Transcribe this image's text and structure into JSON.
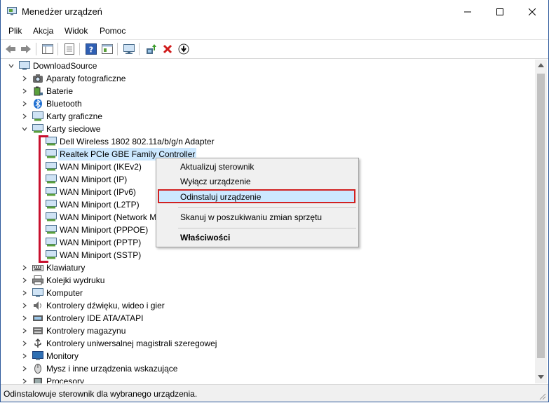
{
  "window": {
    "title": "Menedżer urządzeń",
    "controls": [
      "minimize",
      "maximize",
      "close"
    ]
  },
  "menu": [
    "Plik",
    "Akcja",
    "Widok",
    "Pomoc"
  ],
  "toolbar": {
    "buttons": [
      "back-icon",
      "forward-icon",
      "show-hide-tree-icon",
      "properties-icon",
      "help-icon",
      "view-icon",
      "monitor-icon",
      "update-driver-icon",
      "uninstall-icon",
      "download-icon"
    ]
  },
  "tree": {
    "root": "DownloadSource",
    "categories_before": [
      "Aparaty fotograficzne",
      "Baterie",
      "Bluetooth",
      "Karty graficzne"
    ],
    "expanded_category": "Karty sieciowe",
    "network_adapters": [
      "Dell Wireless 1802 802.11a/b/g/n Adapter",
      "Realtek PCIe GBE Family Controller",
      "WAN Miniport (IKEv2)",
      "WAN Miniport (IP)",
      "WAN Miniport (IPv6)",
      "WAN Miniport (L2TP)",
      "WAN Miniport (Network Monitor)",
      "WAN Miniport (PPPOE)",
      "WAN Miniport (PPTP)",
      "WAN Miniport (SSTP)"
    ],
    "selected_adapter": "Realtek PCIe GBE Family Controller",
    "categories_after": [
      "Klawiatury",
      "Kolejki wydruku",
      "Komputer",
      "Kontrolery dźwięku, wideo i gier",
      "Kontrolery IDE ATA/ATAPI",
      "Kontrolery magazynu",
      "Kontrolery uniwersalnej magistrali szeregowej",
      "Monitory",
      "Mysz i inne urządzenia wskazujące",
      "Procesory"
    ]
  },
  "context_menu": {
    "items": [
      {
        "label": "Aktualizuj sterownik"
      },
      {
        "label": "Wyłącz urządzenie"
      },
      {
        "label": "Odinstaluj urządzenie",
        "highlighted": true
      },
      {
        "label": "Skanuj w poszukiwaniu zmian sprzętu"
      },
      {
        "label": "Właściwości",
        "bold": true
      }
    ]
  },
  "status": "Odinstalowuje sterownik dla wybranego urządzenia.",
  "colors": {
    "selection": "#cce8ff",
    "annotation_red": "#c8102e",
    "folder_blue": "#3c8fd6"
  }
}
